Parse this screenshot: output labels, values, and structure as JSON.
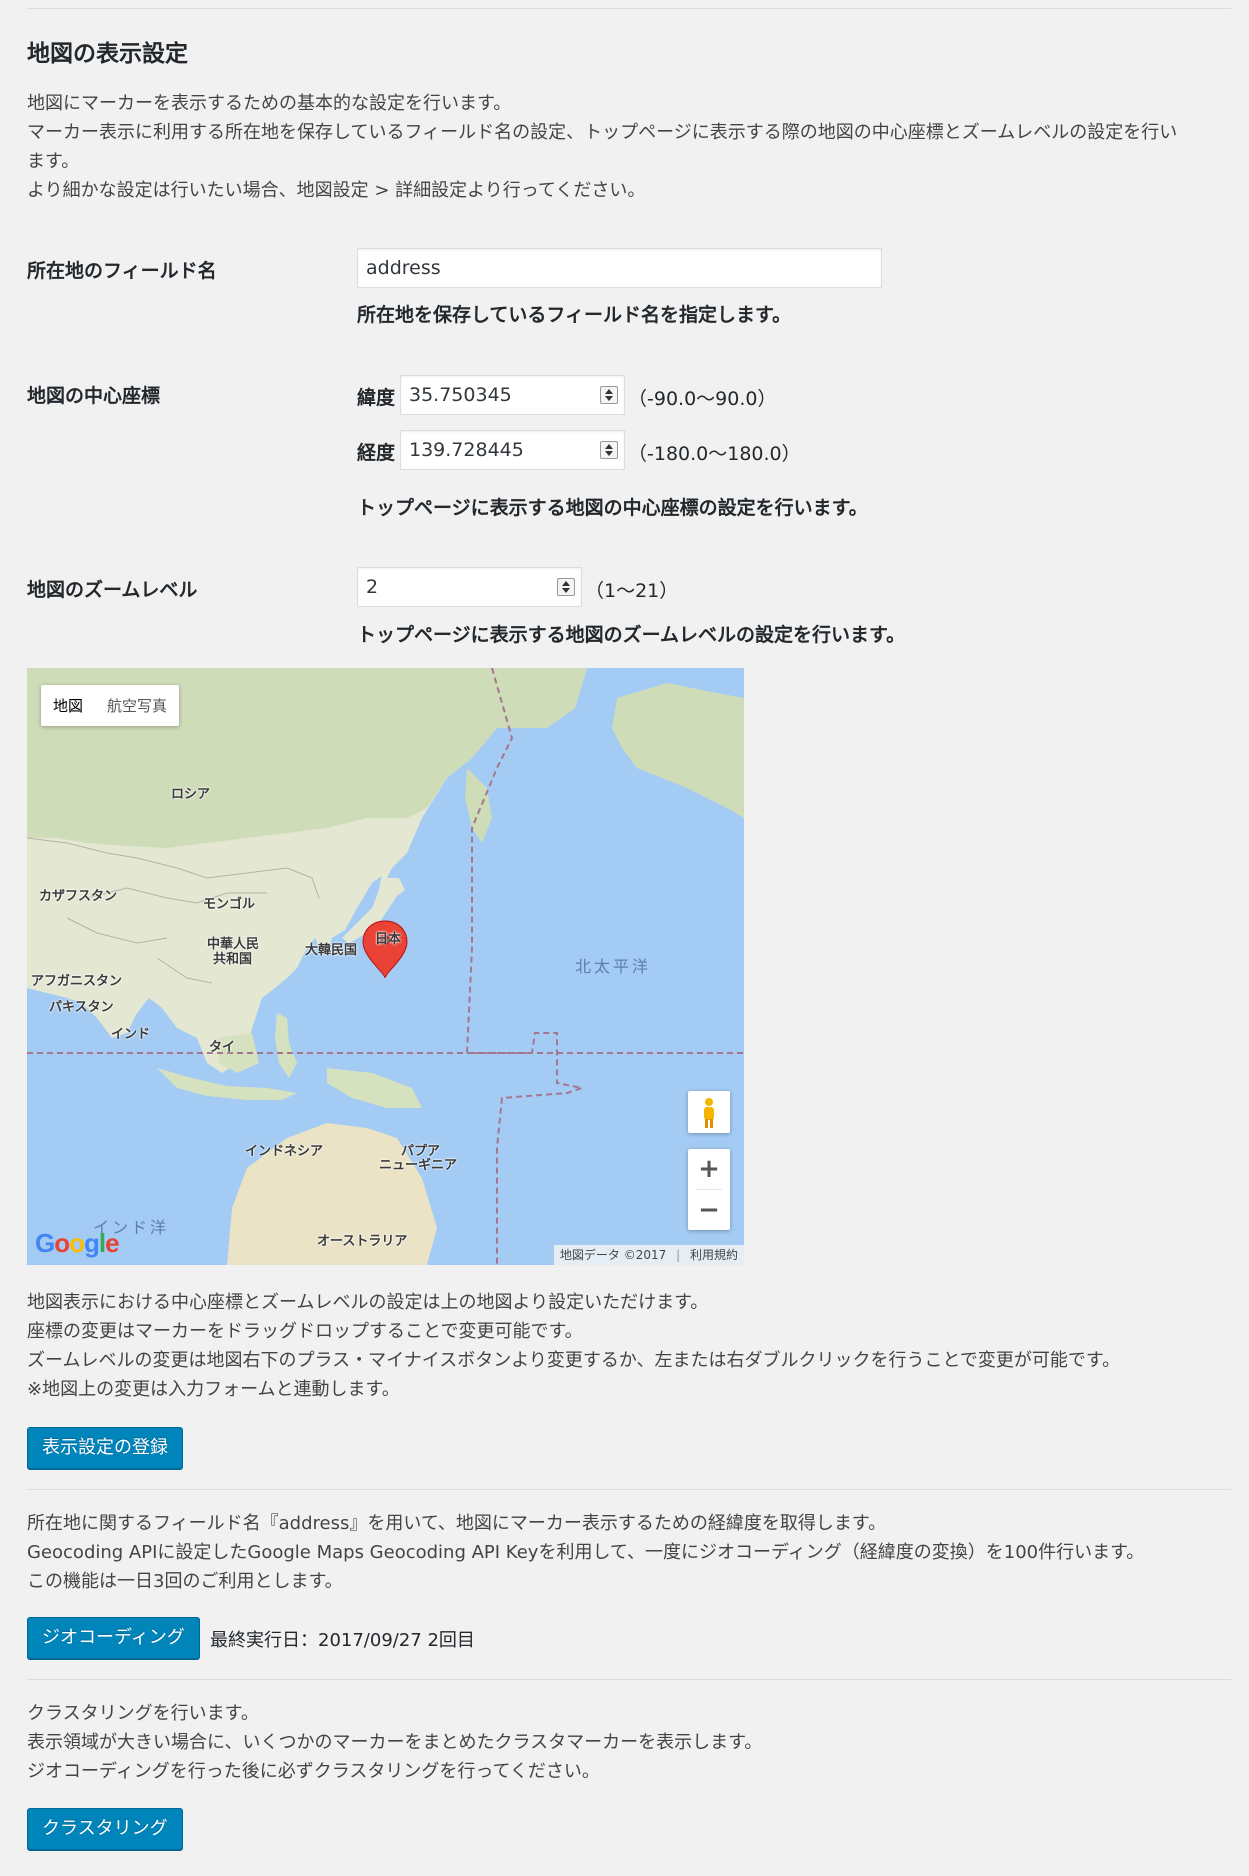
{
  "title": "地図の表示設定",
  "intro": [
    "地図にマーカーを表示するための基本的な設定を行います。",
    "マーカー表示に利用する所在地を保存しているフィールド名の設定、トップページに表示する際の地図の中心座標とズームレベルの設定を行い",
    "ます。",
    "より細かな設定は行いたい場合、地図設定 > 詳細設定より行ってください。"
  ],
  "field_name": {
    "label": "所在地のフィールド名",
    "value": "address",
    "description": "所在地を保存しているフィールド名を指定します。"
  },
  "center": {
    "label": "地図の中心座標",
    "lat_label": "緯度",
    "lat_value": "35.750345",
    "lat_range": "（-90.0〜90.0）",
    "lng_label": "経度",
    "lng_value": "139.728445",
    "lng_range": "（-180.0〜180.0）",
    "description": "トップページに表示する地図の中心座標の設定を行います。"
  },
  "zoom": {
    "label": "地図のズームレベル",
    "value": "2",
    "range": "（1〜21）",
    "description": "トップページに表示する地図のズームレベルの設定を行います。"
  },
  "map": {
    "type_map": "地図",
    "type_satellite": "航空写真",
    "labels": {
      "russia": "ロシア",
      "kazakhstan": "カザフスタン",
      "mongolia": "モンゴル",
      "china_1": "中華人民",
      "china_2": "共和国",
      "korea": "大韓民国",
      "japan": "日本",
      "afghanistan": "アフガニスタン",
      "pakistan": "パキスタン",
      "india": "インド",
      "thailand": "タイ",
      "indonesia": "インドネシア",
      "papua_1": "パプア",
      "papua_2": "ニューギニア",
      "australia": "オーストラリア",
      "pacific": "北太平洋",
      "indian_ocean": "インド洋"
    },
    "zoom_in": "+",
    "zoom_out": "−",
    "logo": "Google",
    "attribution": "地図データ ©2017",
    "terms": "利用規約",
    "colors": {
      "water": "#a3cbf4",
      "land": "#e8e6d5",
      "marker": "#ea4335"
    }
  },
  "map_help": [
    "地図表示における中心座標とズームレベルの設定は上の地図より設定いただけます。",
    "座標の変更はマーカーをドラッグドロップすることで変更可能です。",
    "ズームレベルの変更は地図右下のプラス・マイナイスボタンより変更するか、左または右ダブルクリックを行うことで変更が可能です。",
    "※地図上の変更は入力フォームと連動します。"
  ],
  "save_button": "表示設定の登録",
  "geocoding": {
    "lines": [
      "所在地に関するフィールド名『address』を用いて、地図にマーカー表示するための経緯度を取得します。",
      "Geocoding APIに設定したGoogle Maps Geocoding API Keyを利用して、一度にジオコーディング（経緯度の変換）を100件行います。",
      "この機能は一日3回のご利用とします。"
    ],
    "button": "ジオコーディング",
    "last_run": "最終実行日：2017/09/27 2回目"
  },
  "clustering": {
    "lines": [
      "クラスタリングを行います。",
      "表示領域が大きい場合に、いくつかのマーカーをまとめたクラスタマーカーを表示します。",
      "ジオコーディングを行った後に必ずクラスタリングを行ってください。"
    ],
    "button": "クラスタリング"
  },
  "colors": {
    "page_bg": "#f1f1f1",
    "button_bg": "#0085ba",
    "button_border": "#006799"
  }
}
